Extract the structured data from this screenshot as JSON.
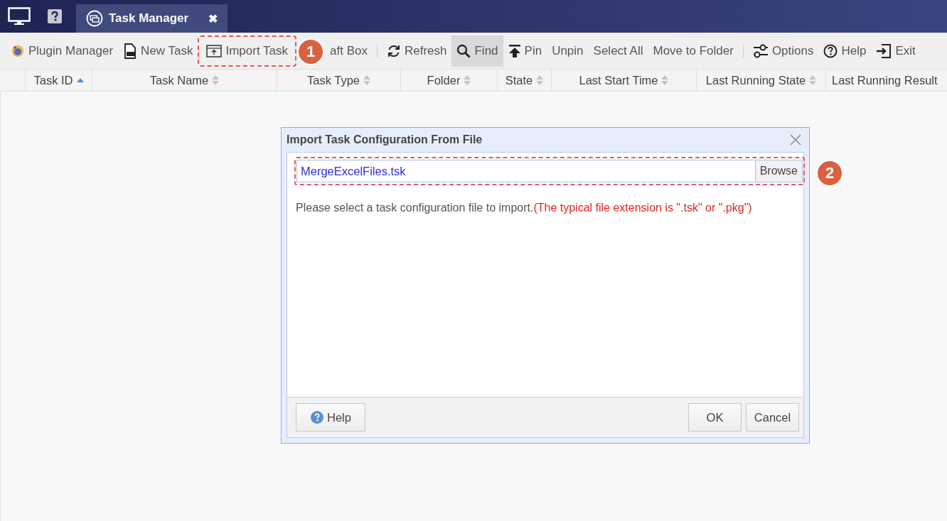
{
  "title_bar": {
    "tab": {
      "title": "Task Manager",
      "close": "✖",
      "selected": true
    }
  },
  "toolbar": {
    "items": [
      {
        "kind": "button",
        "label": "Plugin Manager",
        "active": false,
        "highlighted": false
      },
      {
        "kind": "button",
        "label": "New Task",
        "active": false,
        "highlighted": false
      },
      {
        "kind": "button",
        "label": "Import Task",
        "active": false,
        "highlighted": true,
        "badge": "1"
      },
      {
        "kind": "button",
        "label": "aft Box",
        "active": false,
        "highlighted": false
      },
      {
        "kind": "separator"
      },
      {
        "kind": "button",
        "label": "Refresh",
        "active": false,
        "highlighted": false
      },
      {
        "kind": "button",
        "label": "Find",
        "active": true,
        "highlighted": false
      },
      {
        "kind": "button",
        "label": "Pin",
        "active": false,
        "highlighted": false
      },
      {
        "kind": "button",
        "label": "Unpin",
        "active": false,
        "highlighted": false
      },
      {
        "kind": "button",
        "label": "Select All",
        "active": false,
        "highlighted": false
      },
      {
        "kind": "button",
        "label": "Move to Folder",
        "active": false,
        "highlighted": false
      },
      {
        "kind": "separator"
      },
      {
        "kind": "button",
        "label": "Options",
        "active": false,
        "highlighted": false
      },
      {
        "kind": "button",
        "label": "Help",
        "active": false,
        "highlighted": false
      },
      {
        "kind": "button",
        "label": "Exit",
        "active": false,
        "highlighted": false
      }
    ]
  },
  "table": {
    "columns": [
      {
        "label": "Task ID",
        "sorted": true
      },
      {
        "label": "Task Name",
        "sorted": false
      },
      {
        "label": "Task Type",
        "sorted": false
      },
      {
        "label": "Folder",
        "sorted": false
      },
      {
        "label": "State",
        "sorted": false
      },
      {
        "label": "Last Start Time",
        "sorted": false
      },
      {
        "label": "Last Running State",
        "sorted": false
      },
      {
        "label": "Last Running Result"
      }
    ]
  },
  "dialog": {
    "title": "Import Task Configuration From File",
    "file_field": {
      "value": "MergeExcelFiles.tsk",
      "browse": "Browse",
      "highlighted": true,
      "badge": "2"
    },
    "message": "Please select a task configuration file to import.",
    "note": "(The typical file extension is \".tsk\" or \".pkg\")",
    "buttons": [
      {
        "label": "Help",
        "kind": "help"
      },
      {
        "label": "OK",
        "kind": "plain"
      },
      {
        "label": "Cancel",
        "kind": "plain"
      }
    ]
  }
}
